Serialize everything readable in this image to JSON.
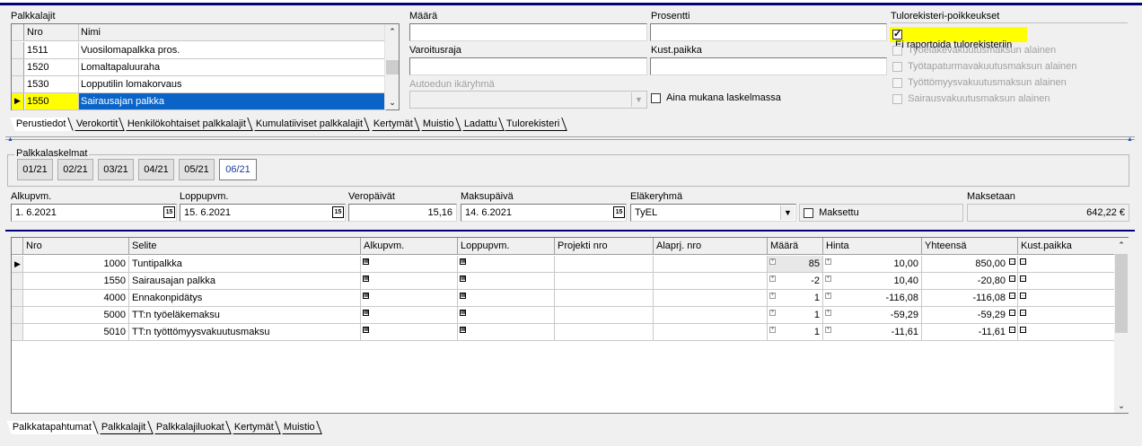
{
  "palkkalajit": {
    "label": "Palkkalajit",
    "columns": [
      "Nro",
      "Nimi"
    ],
    "rows": [
      {
        "nro": "1511",
        "nimi": "Vuosilomapalkka pros."
      },
      {
        "nro": "1520",
        "nimi": "Lomaltapaluuraha"
      },
      {
        "nro": "1530",
        "nimi": "Lopputilin lomakorvaus"
      },
      {
        "nro": "1550",
        "nimi": "Sairausajan palkka"
      }
    ]
  },
  "fields": {
    "maara_label": "Määrä",
    "maara_value": "",
    "prosentti_label": "Prosentti",
    "prosentti_value": "",
    "varoitusraja_label": "Varoitusraja",
    "varoitusraja_value": "",
    "kustpaikka_label": "Kust.paikka",
    "kustpaikka_value": "",
    "autoedun_label": "Autoedun ikäryhmä",
    "autoedun_value": "",
    "aina_mukana_label": "Aina mukana laskelmassa"
  },
  "tulorekisteri": {
    "title": "Tulorekisteri-poikkeukset",
    "items": [
      {
        "label": "Ei raportoida tulorekisteriin",
        "checked": true,
        "enabled": true
      },
      {
        "label": "Työeläkevakuutusmaksun alainen",
        "checked": false,
        "enabled": false
      },
      {
        "label": "Työtapaturmavakuutusmaksun alainen",
        "checked": false,
        "enabled": false
      },
      {
        "label": "Työttömyysvakuutusmaksun alainen",
        "checked": false,
        "enabled": false
      },
      {
        "label": "Sairausvakuutusmaksun alainen",
        "checked": false,
        "enabled": false
      }
    ]
  },
  "top_tabs": [
    "Perustiedot",
    "Verokortit",
    "Henkilökohtaiset palkkalajit",
    "Kumulatiiviset palkkalajit",
    "Kertymät",
    "Muistio",
    "Ladattu",
    "Tulorekisteri"
  ],
  "palkkalaskelmat": {
    "label": "Palkkalaskelmat",
    "buttons": [
      "01/21",
      "02/21",
      "03/21",
      "04/21",
      "05/21",
      "06/21"
    ],
    "active": "06/21"
  },
  "details": {
    "alkupvm_label": "Alkupvm.",
    "alkupvm_value": "1. 6.2021",
    "loppupvm_label": "Loppupvm.",
    "loppupvm_value": "15. 6.2021",
    "veropaivat_label": "Veropäivät",
    "veropaivat_value": "15,16",
    "maksupaiva_label": "Maksupäivä",
    "maksupaiva_value": "14. 6.2021",
    "elakeryhma_label": "Eläkeryhmä",
    "elakeryhma_value": "TyEL",
    "maksettu_label": "Maksettu",
    "maksetaan_label": "Maksetaan",
    "maksetaan_value": "642,22 €"
  },
  "table": {
    "columns": [
      "Nro",
      "Selite",
      "Alkupvm.",
      "Loppupvm.",
      "Projekti nro",
      "Alaprj. nro",
      "Määrä",
      "Hinta",
      "Yhteensä",
      "Kust.paikka"
    ],
    "rows": [
      {
        "nro": "1000",
        "selite": "Tuntipalkka",
        "maara": "85",
        "hinta": "10,00",
        "yhteensa": "850,00"
      },
      {
        "nro": "1550",
        "selite": "Sairausajan palkka",
        "maara": "-2",
        "hinta": "10,40",
        "yhteensa": "-20,80"
      },
      {
        "nro": "4000",
        "selite": "Ennakonpidätys",
        "maara": "1",
        "hinta": "-116,08",
        "yhteensa": "-116,08"
      },
      {
        "nro": "5000",
        "selite": "TT:n työeläkemaksu",
        "maara": "1",
        "hinta": "-59,29",
        "yhteensa": "-59,29"
      },
      {
        "nro": "5010",
        "selite": "TT:n työttömyysvakuutusmaksu",
        "maara": "1",
        "hinta": "-11,61",
        "yhteensa": "-11,61"
      }
    ]
  },
  "bottom_tabs": [
    "Palkkatapahtumat",
    "Palkkalajit",
    "Palkkalajiluokat",
    "Kertymät",
    "Muistio"
  ],
  "colors": {
    "selection": "#0a64c8",
    "highlight": "#ffff00",
    "header_line": "#00007a",
    "active_period": "#1a3d9a"
  }
}
